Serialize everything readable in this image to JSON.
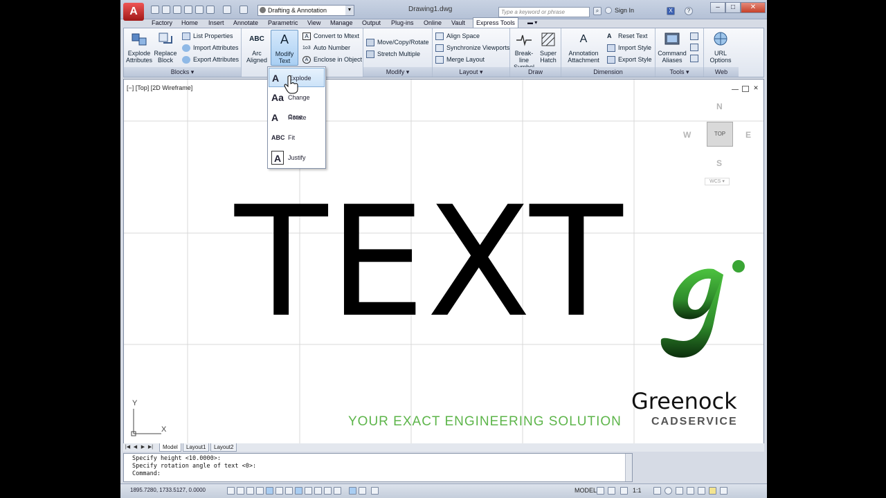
{
  "titlebar": {
    "workspace": "Drafting & Annotation",
    "document_title": "Drawing1.dwg",
    "search_placeholder": "Type a keyword or phrase",
    "signin": "Sign In"
  },
  "ribbon_tabs": [
    "Factory",
    "Home",
    "Insert",
    "Annotate",
    "Parametric",
    "View",
    "Manage",
    "Output",
    "Plug-ins",
    "Online",
    "Vault",
    "Express Tools"
  ],
  "active_tab": "Express Tools",
  "ribbon": {
    "blocks": {
      "title": "Blocks",
      "explode_attributes": "Explode\nAttributes",
      "replace_block": "Replace\nBlock",
      "list_properties": "List Properties",
      "import_attributes": "Import Attributes",
      "export_attributes": "Export Attributes"
    },
    "text": {
      "arc_aligned": "Arc\nAligned",
      "modify_text": "Modify\nText",
      "convert_to_mtext": "Convert to Mtext",
      "auto_number": "Auto Number",
      "enclose_in_object": "Enclose in Object"
    },
    "modify": {
      "title": "Modify",
      "move_copy_rotate": "Move/Copy/Rotate",
      "stretch_multiple": "Stretch Multiple"
    },
    "layout": {
      "title": "Layout",
      "align_space": "Align Space",
      "synchronize_viewports": "Synchronize Viewports",
      "merge_layout": "Merge Layout"
    },
    "draw": {
      "title": "Draw",
      "break_line_symbol": "Break-line\nSymbol",
      "super_hatch": "Super\nHatch"
    },
    "dimension": {
      "title": "Dimension",
      "annotation_attachment": "Annotation\nAttachment",
      "reset_text": "Reset Text",
      "import_style": "Import Style",
      "export_style": "Export Style"
    },
    "tools": {
      "title": "Tools",
      "command_aliases": "Command\nAliases"
    },
    "web": {
      "title": "Web",
      "url_options": "URL\nOptions"
    }
  },
  "dropdown": {
    "items": [
      {
        "label": "Explode",
        "glyph": "A"
      },
      {
        "label": "Change Case",
        "glyph": "Aa"
      },
      {
        "label": "Rotate",
        "glyph": "A"
      },
      {
        "label": "Fit",
        "glyph": "ABC"
      },
      {
        "label": "Justify",
        "glyph": "A"
      }
    ],
    "highlighted": "Explode"
  },
  "drawing": {
    "viewport_label": "[−] [Top] [2D Wireframe]",
    "main_text": "TEXT",
    "viewcube": {
      "n": "N",
      "s": "S",
      "e": "E",
      "w": "W",
      "top": "TOP",
      "wcs": "WCS"
    },
    "ucs": {
      "x": "X",
      "y": "Y"
    }
  },
  "watermark": {
    "brand": "Greenock",
    "sub": "CADSERVICE",
    "tagline": "YOUR EXACT ENGINEERING SOLUTION",
    "logo_color": "#3aa535"
  },
  "layout_tabs": [
    "Model",
    "Layout1",
    "Layout2"
  ],
  "command_line": {
    "lines": [
      "Specify height <10.0000>:",
      "Specify rotation angle of text <0>:",
      "Command:"
    ]
  },
  "statusbar": {
    "coords": "1895.7280, 1733.5127, 0.0000",
    "model": "MODEL",
    "scale": "1:1"
  },
  "colors": {
    "accent": "#a9cff3",
    "tagline_green": "#5db54a"
  }
}
